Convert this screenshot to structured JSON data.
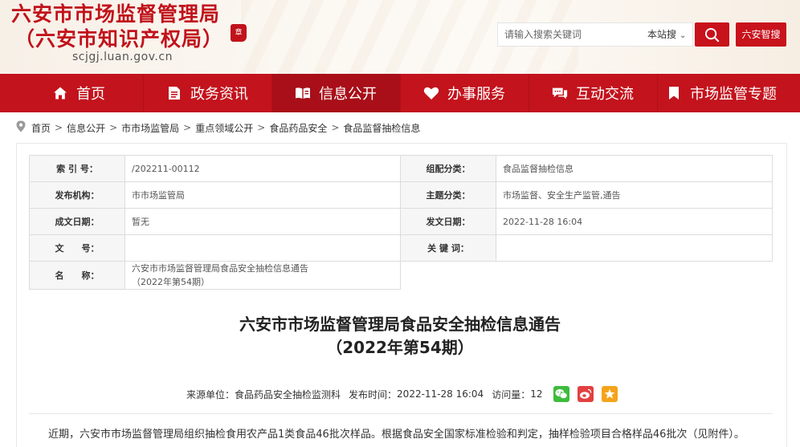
{
  "header": {
    "title_line1": "六安市市场监督管理局",
    "title_line2": "（六安市知识产权局）",
    "seal_text": "章",
    "domain": "scjgj.luan.gov.cn",
    "search_placeholder": "请输入搜索关键词",
    "scope_label": "本站搜",
    "smart_search_label": "六安智搜",
    "accent_color": "#c3131d"
  },
  "nav": {
    "items": [
      {
        "label": "首页",
        "icon": "home-icon"
      },
      {
        "label": "政务资讯",
        "icon": "document-icon"
      },
      {
        "label": "信息公开",
        "icon": "open-book-icon"
      },
      {
        "label": "办事服务",
        "icon": "heart-icon"
      },
      {
        "label": "互动交流",
        "icon": "chat-icon"
      },
      {
        "label": "市场监管专题",
        "icon": "bookmark-icon"
      }
    ],
    "active_index": 2
  },
  "breadcrumb": [
    "首页",
    "信息公开",
    "市市场监管局",
    "重点领域公开",
    "食品药品安全",
    "食品监督抽检信息"
  ],
  "meta": {
    "index_label": "索 引 号：",
    "index_value": "/202211-00112",
    "category_label": "组配分类：",
    "category_value": "食品监督抽检信息",
    "publisher_label": "发布机构：",
    "publisher_value": "市市场监管局",
    "topic_label": "主题分类：",
    "topic_value": "市场监督、安全生产监管,通告",
    "written_label": "成文日期：",
    "written_value": "暂无",
    "published_label": "发文日期：",
    "published_value": "2022-11-28 16:04",
    "docno_label": "文　　号：",
    "docno_value": "",
    "keywords_label": "关 键 词：",
    "keywords_value": "",
    "name_label": "名　　称：",
    "name_value_line1": "六安市市场监督管理局食品安全抽检信息通告",
    "name_value_line2": "（2022年第54期）"
  },
  "article": {
    "title_line1": "六安市市场监督管理局食品安全抽检信息通告",
    "title_line2": "（2022年第54期）",
    "source_label": "来源单位：",
    "source_value": "食品药品安全抽检监测科",
    "time_label": "发布时间：",
    "time_value": "2022-11-28 16:04",
    "views_label": "访问量：",
    "views_value": "12",
    "body_first_line": "近期，六安市市场监督管理局组织抽检食用农产品1类食品46批次样品。根据食品安全国家标准检验和判定，抽样检验项目合格样品46批次（见附件）。"
  }
}
